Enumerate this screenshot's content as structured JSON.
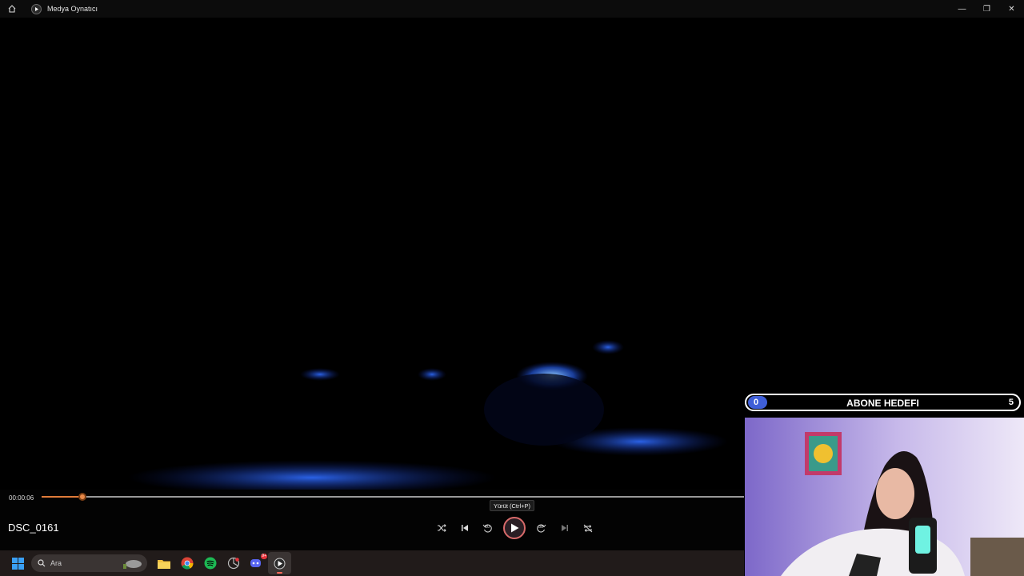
{
  "window": {
    "title": "Medya Oynatıcı",
    "controls": {
      "minimize": "—",
      "restore": "❐",
      "close": "✕"
    }
  },
  "player": {
    "current_time": "00:00:06",
    "progress_percent": 5.8,
    "filename": "DSC_0161",
    "tooltip": "Yürüt (Ctrl+P)",
    "skip_back_label": "10",
    "skip_forward_label": "30",
    "accent_color": "#e07b3a"
  },
  "taskbar": {
    "search_placeholder": "Ara",
    "apps": [
      "windows-start",
      "file-explorer",
      "chrome",
      "spotify",
      "app-generic",
      "discord",
      "media-player"
    ],
    "discord_badge": "9+"
  },
  "overlay": {
    "goal_title": "ABONE HEDEFI",
    "goal_current": "0",
    "goal_target": "5",
    "goal_color": "#3f5fd8"
  }
}
